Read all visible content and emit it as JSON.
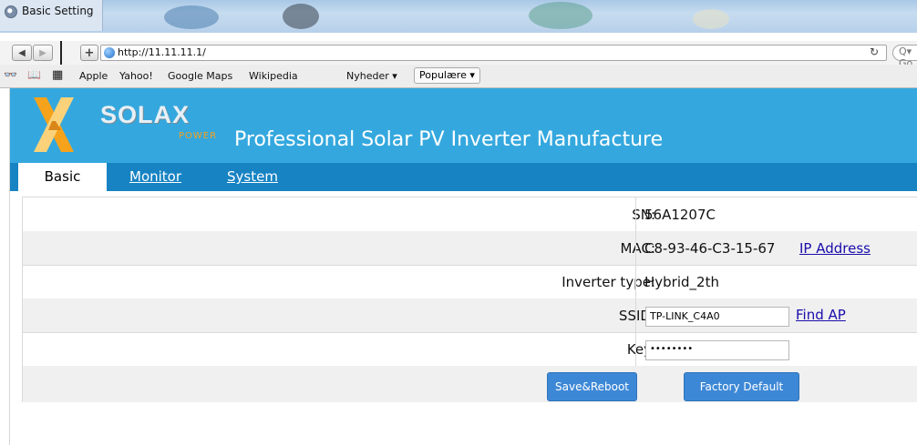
{
  "window": {
    "title": "Basic Setting"
  },
  "browser": {
    "back_glyph": "◀",
    "forward_glyph": "▶",
    "add_glyph": "+",
    "url": "http://11.11.11.1/",
    "reload_glyph": "↻",
    "search_placeholder": "Q▾ Go",
    "bookmarks": {
      "reader_glyph": "👓",
      "book_glyph": "📖",
      "grid_glyph": "▦",
      "items": [
        "Apple",
        "Yahoo!",
        "Google Maps",
        "Wikipedia",
        "Nyheder ▾"
      ],
      "popular": "Populære ▾"
    }
  },
  "banner": {
    "brand": "SOLAX",
    "brand_sub": "POWER",
    "title": "Professional Solar PV Inverter Manufacture"
  },
  "tabs": [
    {
      "label": "Basic",
      "active": true
    },
    {
      "label": "Monitor",
      "active": false
    },
    {
      "label": "System",
      "active": false
    }
  ],
  "form": {
    "sn_label": "SN:",
    "sn_value": "56A1207C",
    "mac_label": "MAC:",
    "mac_value": "C8-93-46-C3-15-67",
    "ip_link": "IP Address",
    "inverter_label": "Inverter type:",
    "inverter_value": "Hybrid_2th",
    "ssid_label": "SSID:",
    "ssid_value": "TP-LINK_C4A0",
    "find_ap_link": "Find AP",
    "key_label": "Key:",
    "key_value": "••••••••",
    "save_button": "Save&Reboot",
    "factory_button": "Factory Default"
  },
  "colors": {
    "banner": "#34a8de",
    "navbar": "#1783c3",
    "button": "#3d88d6",
    "logo_orange": "#f7a21b"
  }
}
